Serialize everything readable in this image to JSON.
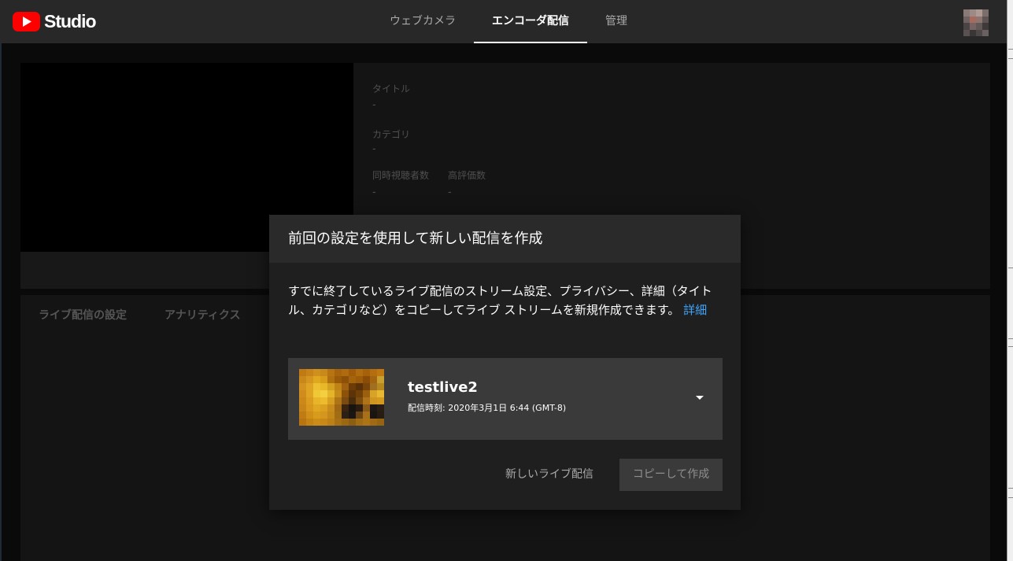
{
  "header": {
    "brand": "Studio",
    "tabs": [
      {
        "label": "ウェブカメラ",
        "active": false
      },
      {
        "label": "エンコーダ配信",
        "active": true
      },
      {
        "label": "管理",
        "active": false
      }
    ]
  },
  "background": {
    "info": {
      "title_label": "タイトル",
      "title_value": "-",
      "category_label": "カテゴリ",
      "category_value": "-",
      "viewers_label": "同時視聴者数",
      "viewers_value": "-",
      "likes_label": "高評価数",
      "likes_value": "-"
    },
    "subtabs": [
      "ライブ配信の設定",
      "アナリティクス"
    ]
  },
  "dialog": {
    "title": "前回の設定を使用して新しい配信を作成",
    "description": "すでに終了しているライブ配信のストリーム設定、プライバシー、詳細（タイトル、カテゴリなど）をコピーしてライブ ストリームを新規作成できます。",
    "learn_more": "詳細",
    "stream": {
      "title": "testlive2",
      "time": "配信時刻: 2020年3月1日 6:44 (GMT-8)"
    },
    "new_button": "新しいライブ配信",
    "copy_button": "コピーして作成"
  },
  "colors": {
    "accent_link": "#3ea6ff",
    "brand_red": "#ff0000"
  }
}
